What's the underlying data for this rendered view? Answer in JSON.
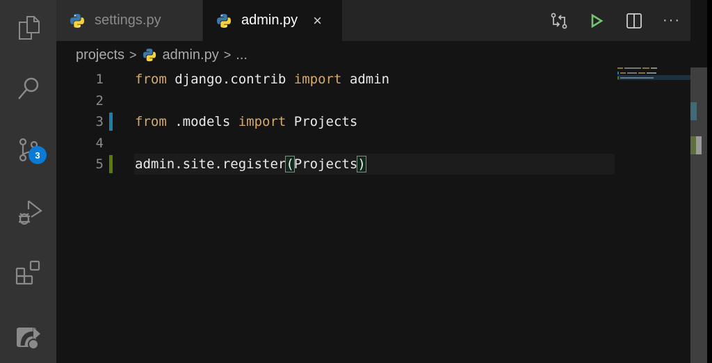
{
  "activity_bar": {
    "items": [
      {
        "name": "explorer",
        "icon": "files-icon"
      },
      {
        "name": "search",
        "icon": "search-icon"
      },
      {
        "name": "source-control",
        "icon": "source-control-icon",
        "badge": "3"
      },
      {
        "name": "run-debug",
        "icon": "run-debug-icon"
      },
      {
        "name": "extensions",
        "icon": "extensions-icon"
      },
      {
        "name": "live-share",
        "icon": "live-share-icon"
      }
    ]
  },
  "tabs": [
    {
      "label": "settings.py",
      "active": false
    },
    {
      "label": "admin.py",
      "active": true,
      "close_icon": "×"
    }
  ],
  "editor_actions": [
    "open-changes-icon",
    "run-icon",
    "split-editor-icon",
    "more-actions-icon"
  ],
  "more_label": "···",
  "breadcrumb": {
    "folder": "projects",
    "file": "admin.py",
    "tail": "...",
    "separator": ">"
  },
  "editor": {
    "lines": [
      {
        "number": "1",
        "tokens": [
          {
            "t": "from",
            "k": true
          },
          {
            "t": " django.contrib "
          },
          {
            "t": "import",
            "k": true
          },
          {
            "t": " admin"
          }
        ]
      },
      {
        "number": "2",
        "tokens": []
      },
      {
        "number": "3",
        "tokens": [
          {
            "t": "from",
            "k": true
          },
          {
            "t": " .models "
          },
          {
            "t": "import",
            "k": true
          },
          {
            "t": " Projects"
          }
        ],
        "gutter": "modified"
      },
      {
        "number": "4",
        "tokens": []
      },
      {
        "number": "5",
        "tokens": [
          {
            "t": "admin.site.register"
          },
          {
            "t": "(",
            "b": true
          },
          {
            "t": "Projects"
          },
          {
            "t": ")",
            "b": true
          }
        ],
        "gutter": "added",
        "current": true
      }
    ]
  },
  "colors": {
    "keyword": "#d4aa6a",
    "gutter_modified": "#1b81a8",
    "gutter_added": "#587c0c",
    "badge": "#0a7ad4",
    "run": "#73c46f"
  }
}
